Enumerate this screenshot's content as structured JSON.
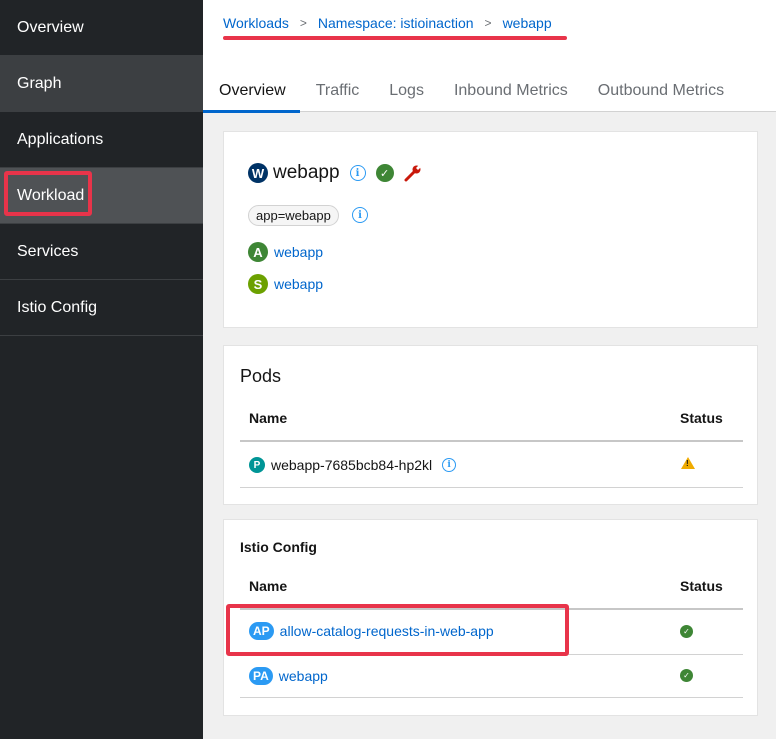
{
  "sidebar": {
    "items": [
      {
        "label": "Overview"
      },
      {
        "label": "Graph"
      },
      {
        "label": "Applications"
      },
      {
        "label": "Workload"
      },
      {
        "label": "Services"
      },
      {
        "label": "Istio Config"
      }
    ]
  },
  "breadcrumb": {
    "items": [
      "Workloads",
      "Namespace: istioinaction",
      "webapp"
    ],
    "separator": ">"
  },
  "tabs": [
    "Overview",
    "Traffic",
    "Logs",
    "Inbound Metrics",
    "Outbound Metrics"
  ],
  "workload": {
    "badge": "W",
    "name": "webapp",
    "label": "app=webapp",
    "app_badge": "A",
    "app_link": "webapp",
    "service_badge": "S",
    "service_link": "webapp"
  },
  "pods": {
    "title": "Pods",
    "col_name": "Name",
    "col_status": "Status",
    "rows": [
      {
        "badge": "P",
        "name": "webapp-7685bcb84-hp2kl",
        "status": "warning"
      }
    ]
  },
  "istio_config": {
    "title": "Istio Config",
    "col_name": "Name",
    "col_status": "Status",
    "rows": [
      {
        "badge": "AP",
        "name": "allow-catalog-requests-in-web-app",
        "status": "ok"
      },
      {
        "badge": "PA",
        "name": "webapp",
        "status": "ok"
      }
    ]
  },
  "colors": {
    "accent": "#0066cc",
    "highlight": "#e8344a",
    "ok": "#3e8635",
    "warning": "#f0ab00",
    "sidebar_bg": "#212427"
  }
}
